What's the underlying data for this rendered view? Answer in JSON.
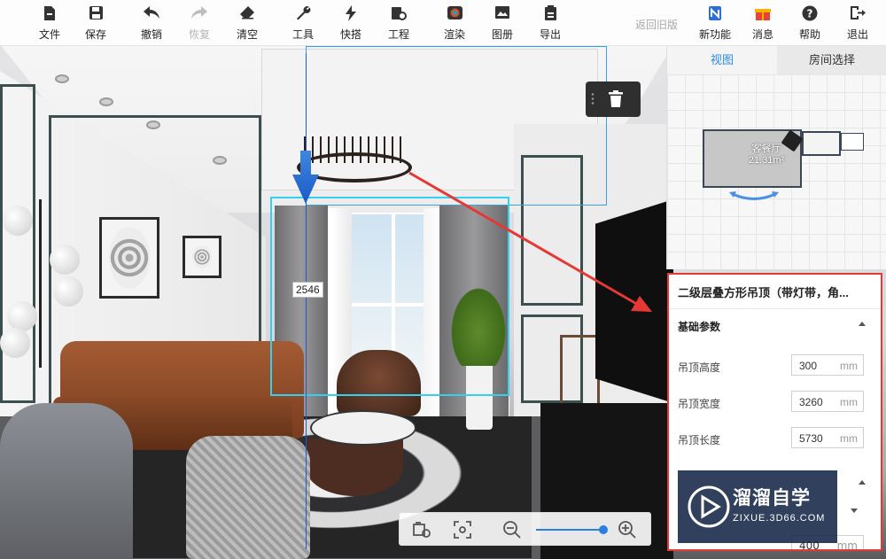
{
  "toolbar": {
    "items": [
      {
        "id": "file",
        "label": "文件",
        "icon": "file-icon"
      },
      {
        "id": "save",
        "label": "保存",
        "icon": "save-icon"
      },
      {
        "id": "undo",
        "label": "撤销",
        "icon": "undo-icon"
      },
      {
        "id": "redo",
        "label": "恢复",
        "icon": "redo-icon",
        "disabled": true
      },
      {
        "id": "clear",
        "label": "清空",
        "icon": "eraser-icon"
      },
      {
        "id": "tools",
        "label": "工具",
        "icon": "wrench-icon"
      },
      {
        "id": "quick",
        "label": "快搭",
        "icon": "lightning-icon"
      },
      {
        "id": "project",
        "label": "工程",
        "icon": "project-icon"
      },
      {
        "id": "render",
        "label": "渲染",
        "icon": "camera-icon"
      },
      {
        "id": "album",
        "label": "图册",
        "icon": "image-icon"
      },
      {
        "id": "export",
        "label": "导出",
        "icon": "export-icon"
      }
    ],
    "return_old": "返回旧版",
    "right_items": [
      {
        "id": "new",
        "label": "新功能",
        "icon": "new-feature-icon"
      },
      {
        "id": "messages",
        "label": "消息",
        "icon": "gift-icon"
      },
      {
        "id": "help",
        "label": "帮助",
        "icon": "help-icon"
      },
      {
        "id": "exit",
        "label": "退出",
        "icon": "exit-icon"
      }
    ]
  },
  "view_panel": {
    "tabs": [
      {
        "label": "视图",
        "active": true
      },
      {
        "label": "房间选择",
        "active": false
      }
    ],
    "room_name": "客餐厅",
    "room_area": "21.31m²"
  },
  "scene": {
    "dimension_label": "2546"
  },
  "properties": {
    "title": "二级层叠方形吊顶（带灯带，角...",
    "section": "基础参数",
    "params": [
      {
        "label": "吊顶高度",
        "value": "300",
        "unit": "mm"
      },
      {
        "label": "吊顶宽度",
        "value": "3260",
        "unit": "mm"
      },
      {
        "label": "吊顶长度",
        "value": "5730",
        "unit": "mm"
      }
    ],
    "partial_value": "400",
    "partial_unit": "mm"
  },
  "zoom": {
    "level": 0.95
  },
  "watermark": {
    "cn": "溜溜自学",
    "en": "ZIXUE.3D66.COM"
  },
  "colors": {
    "accent": "#2d8be6",
    "highlight_border": "#e53935",
    "selection": "#3aa0e8"
  }
}
